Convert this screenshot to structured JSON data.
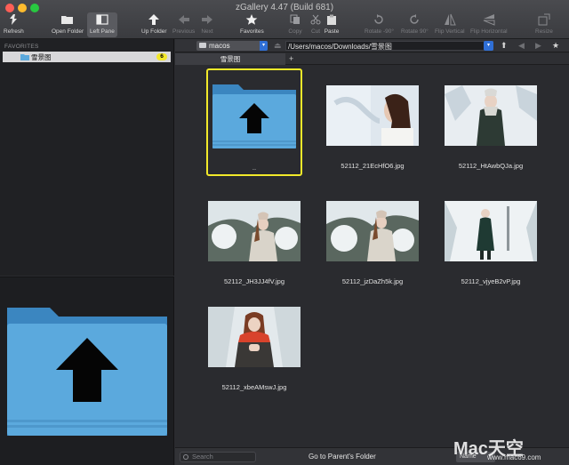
{
  "window": {
    "title": "zGallery 4.47 (Build 681)"
  },
  "toolbar": {
    "refresh": "Refresh",
    "open_folder": "Open Folder",
    "left_pane": "Left Pane",
    "up_folder": "Up Folder",
    "previous": "Previous",
    "next": "Next",
    "favorites": "Favorites",
    "copy": "Copy",
    "cut": "Cut",
    "paste": "Paste",
    "rotate_left": "Rotate -90°",
    "rotate_right": "Rotate 90°",
    "flip_vertical": "Flip Vertical",
    "flip_horizontal": "Flip Horizontal",
    "resize": "Resize"
  },
  "sidebar": {
    "favorites_heading": "FAVORITES",
    "items": [
      {
        "label": "雪景图",
        "count": "6"
      }
    ]
  },
  "pathbar": {
    "volume": "macos",
    "path": "/Users/macos/Downloads/雪景图"
  },
  "tabs": [
    {
      "label": "雪景图"
    }
  ],
  "tab_add": "+",
  "grid": {
    "up_item_label": "..",
    "items": [
      {
        "filename": "52112_21EcHfO6.jpg"
      },
      {
        "filename": "52112_HtAwbQJa.jpg"
      },
      {
        "filename": "52112_JH3JJ4fV.jpg"
      },
      {
        "filename": "52112_jzDaZh5k.jpg"
      },
      {
        "filename": "52112_vjyeB2vP.jpg"
      },
      {
        "filename": "52112_xbeAMswJ.jpg"
      }
    ]
  },
  "statusbar": {
    "search_placeholder": "Search",
    "status": "Go to Parent's Folder",
    "sort": "Name"
  },
  "watermark": {
    "main": "Mac天空",
    "sub": "www.mac69.com"
  },
  "colors": {
    "selection": "#f1e92a",
    "folder_blue": "#5ba9dd",
    "accent_blue": "#2f6fd6",
    "badge": "#f2e82b"
  }
}
